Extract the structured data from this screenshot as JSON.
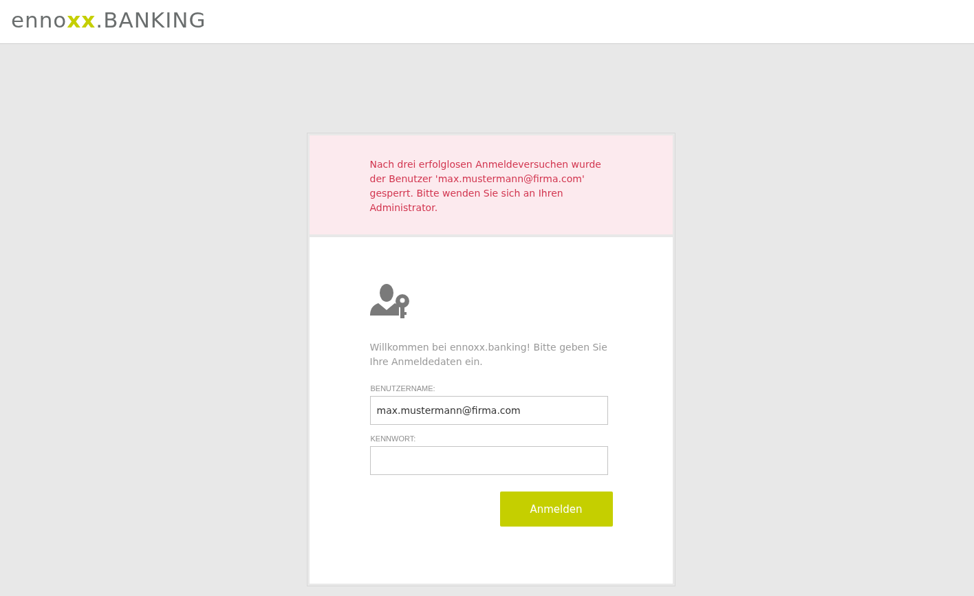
{
  "header": {
    "logo": [
      {
        "text": "enno",
        "kind": "plain"
      },
      {
        "text": "xx",
        "kind": "accent"
      },
      {
        "text": ".BANKING",
        "kind": "plain"
      }
    ]
  },
  "alert": {
    "message": "Nach drei erfolglosen Anmeldeversuchen wurde der Benutzer 'max.mustermann@firma.com' gesperrt. Bitte wenden Sie sich an Ihren Administrator."
  },
  "login": {
    "welcome": "Willkommen bei ennoxx.banking! Bitte geben Sie Ihre Anmeldedaten ein.",
    "fields": [
      {
        "label": "BENUTZERNAME:",
        "value": "max.mustermann@firma.com",
        "kind": "text"
      },
      {
        "label": "KENNWORT:",
        "kind": "password"
      }
    ],
    "button": "Anmelden"
  }
}
